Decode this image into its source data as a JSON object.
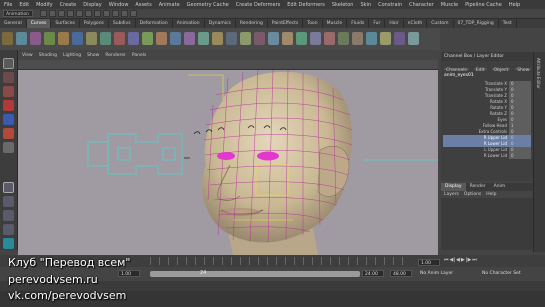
{
  "menubar": {
    "items": [
      "File",
      "Edit",
      "Modify",
      "Create",
      "Display",
      "Window",
      "Assets",
      "Animate",
      "Geometry Cache",
      "Create Deformers",
      "Edit Deformers",
      "Skeleton",
      "Skin",
      "Constrain",
      "Character",
      "Muscle",
      "Pipeline Cache",
      "Help"
    ]
  },
  "status_line": {
    "mode": "Animation"
  },
  "shelf": {
    "tabs": [
      "General",
      "Curves",
      "Surfaces",
      "Polygons",
      "Subdivs",
      "Deformation",
      "Animation",
      "Dynamics",
      "Rendering",
      "PaintEffects",
      "Toon",
      "Muscle",
      "Fluids",
      "Fur",
      "Hair",
      "nCloth",
      "Custom",
      "07_TDP_Rigging",
      "Test"
    ],
    "active_tab": "Curves"
  },
  "viewport": {
    "menu": [
      "View",
      "Shading",
      "Lighting",
      "Show",
      "Renderer",
      "Panels"
    ]
  },
  "channel_box": {
    "title": "Channel Box / Layer Editor",
    "menu": [
      "Channels",
      "Edit",
      "Object",
      "Show"
    ],
    "object_name": "anim_eyes01",
    "channels": [
      {
        "name": "Translate X",
        "value": "0",
        "selected": false
      },
      {
        "name": "Translate Y",
        "value": "0",
        "selected": false
      },
      {
        "name": "Translate Z",
        "value": "0",
        "selected": false
      },
      {
        "name": "Rotate X",
        "value": "0",
        "selected": false
      },
      {
        "name": "Rotate Y",
        "value": "0",
        "selected": false
      },
      {
        "name": "Rotate Z",
        "value": "0",
        "selected": false
      },
      {
        "name": "Eyes",
        "value": "0",
        "selected": false
      },
      {
        "name": "Follow Head",
        "value": "1",
        "selected": false
      },
      {
        "name": "Extra Controls",
        "value": "0",
        "selected": false
      },
      {
        "name": "R Upper Lid",
        "value": "0",
        "selected": true
      },
      {
        "name": "R Lower Lid",
        "value": "0",
        "selected": true
      },
      {
        "name": "L Upper Lid",
        "value": "0",
        "selected": false
      },
      {
        "name": "R Lower Lid",
        "value": "0",
        "selected": false
      }
    ]
  },
  "layer_editor": {
    "tabs": [
      "Display",
      "Render",
      "Anim"
    ],
    "active_tab": "Display",
    "menu": [
      "Layers",
      "Options",
      "Help"
    ]
  },
  "right_sidebar": {
    "label": "Attribute Editor"
  },
  "timeline": {
    "current_frame": "1.00",
    "start_frame": "1.00",
    "range_start": "1.00",
    "range_end_inner": "24",
    "end_frame_a": "24.00",
    "end_frame_b": "48.00",
    "anim_layer": "No Anim Layer",
    "character_set": "No Character Set"
  },
  "watermark": {
    "line1": "Клуб \"Перевод всем\"",
    "line2": "perevodvsem.ru",
    "line3": "vk.com/perevodvsem"
  },
  "colors": {
    "face": "#d0c3a7",
    "wire": "#b52a9a",
    "control": "#4fd6d0",
    "eyes": "#e338d0"
  }
}
